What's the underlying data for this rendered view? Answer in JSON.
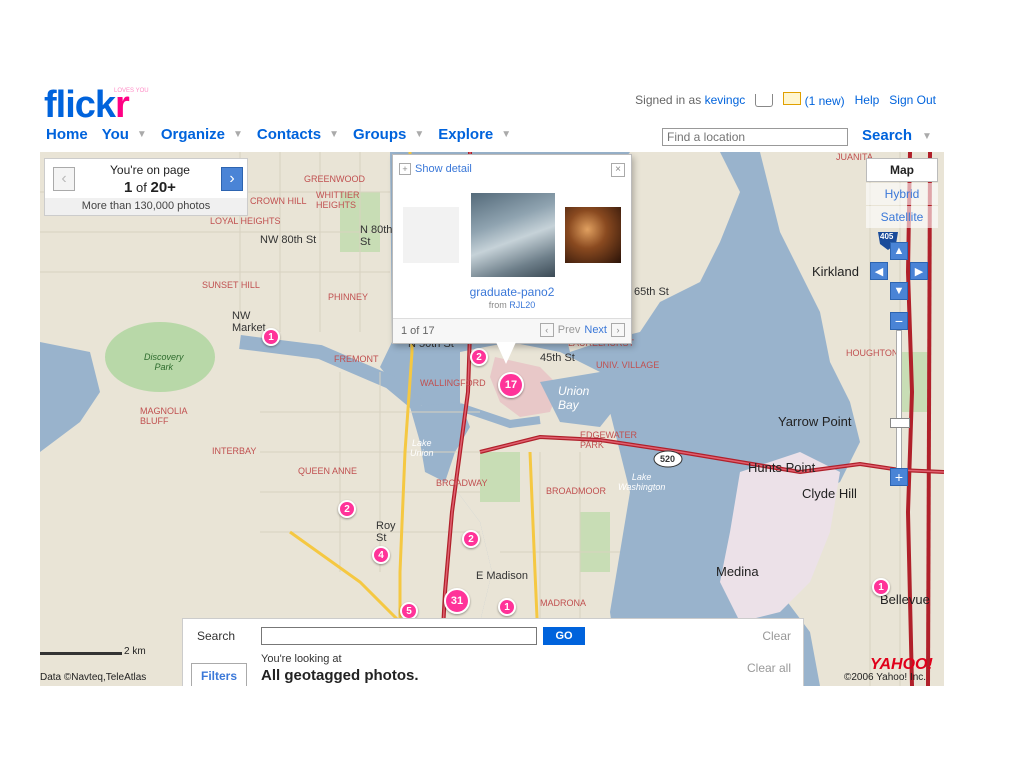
{
  "header": {
    "logo_main": "flickr",
    "logo_tag": "LOVES YOU",
    "signed_in_prefix": "Signed in as",
    "username": "kevingc",
    "mail_count": "(1 new)",
    "help": "Help",
    "sign_out": "Sign Out"
  },
  "nav": {
    "home": "Home",
    "you": "You",
    "organize": "Organize",
    "contacts": "Contacts",
    "groups": "Groups",
    "explore": "Explore"
  },
  "location_search": {
    "placeholder": "Find a location",
    "button": "Search"
  },
  "pager": {
    "line1": "You're on page",
    "page": "1",
    "of": "of",
    "total": "20+",
    "footer": "More than 130,000 photos"
  },
  "map_type": {
    "map": "Map",
    "hybrid": "Hybrid",
    "satellite": "Satellite"
  },
  "popup": {
    "show_detail": "Show detail",
    "photo_title": "graduate-pano2",
    "from_prefix": "from",
    "owner": "RJL20",
    "count": "1 of 17",
    "prev": "Prev",
    "next": "Next"
  },
  "markers": {
    "m1": "1",
    "m2": "2",
    "m17": "17",
    "m2b": "2",
    "m4": "4",
    "m2c": "2",
    "m5": "5",
    "m31": "31",
    "m1b": "1",
    "m1c": "1"
  },
  "map_labels": {
    "greenwood": "GREENWOOD",
    "crown_hill": "CROWN HILL",
    "whittier_heights": "WHITTIER\nHEIGHTS",
    "loyal_heights": "LOYAL HEIGHTS",
    "nw80": "NW 80th St",
    "n80": "N 80th\nSt",
    "sunset_hill": "SUNSET HILL",
    "phinney": "PHINNEY",
    "nw_market": "NW\nMarket",
    "fremont": "FREMONT",
    "wallingford": "WALLINGFORD",
    "n50": "N 50th St",
    "discovery_park": "Discovery\nPark",
    "magnolia_bluff": "MAGNOLIA\nBLUFF",
    "interbay": "INTERBAY",
    "queen_anne": "QUEEN ANNE",
    "roy_st": "Roy\nSt",
    "lake_union": "Lake\nUnion",
    "broadway": "BROADWAY",
    "broadmoor": "BROADMOOR",
    "union_bay": "Union\nBay",
    "laurelhurst": "LAURELHURST",
    "univ_village": "UNIV. VILLAGE",
    "n45": "45th St",
    "n65": "65th St",
    "edgewater_park": "EDGEWATER\nPARK",
    "lake_washington": "Lake\nWashington",
    "madrona": "MADRONA",
    "e_madison": "E Madison",
    "kirkland": "Kirkland",
    "yarrow_point": "Yarrow Point",
    "hunts_point": "Hunts Point",
    "clyde_hill": "Clyde Hill",
    "medina": "Medina",
    "bellevue": "Bellevue",
    "houghton": "HOUGHTON",
    "hwy520": "520",
    "hwy405": "405",
    "juanita": "JUANITA"
  },
  "bottom_panel": {
    "search_label": "Search",
    "go": "GO",
    "clear": "Clear",
    "looking_at": "You're looking at",
    "all_geotagged": "All geotagged photos.",
    "clear_all": "Clear all",
    "filters": "Filters"
  },
  "map_footer": {
    "scale": "2 km",
    "data_credit": "Data ©Navteq,TeleAtlas",
    "copyright": "©2006 Yahoo! Inc.",
    "yahoo_logo": "YAHOO!"
  },
  "colors": {
    "flickr_blue": "#0063dc",
    "flickr_pink": "#ff0084",
    "water": "#99b3cc",
    "land": "#e9e4d6",
    "marker": "#ff3399"
  }
}
